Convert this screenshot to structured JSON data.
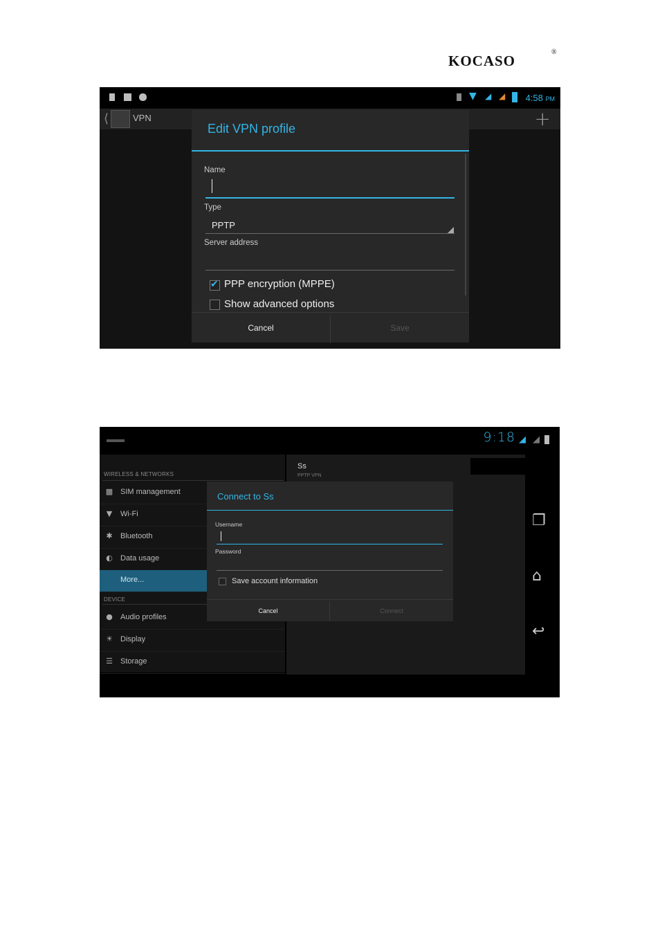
{
  "logo": {
    "brand": "KOCASO",
    "reg_mark": "®"
  },
  "screenshot1": {
    "status_bar": {
      "time": "4:58",
      "ampm": "PM"
    },
    "action_bar": {
      "title": "VPN"
    },
    "dialog": {
      "title": "Edit VPN profile",
      "name_label": "Name",
      "name_value": "",
      "type_label": "Type",
      "type_value": "PPTP",
      "server_label": "Server address",
      "server_value": "",
      "ppp_encryption_label": "PPP encryption (MPPE)",
      "ppp_encryption_checked": true,
      "advanced_label": "Show advanced options",
      "advanced_checked": false,
      "cancel_label": "Cancel",
      "save_label": "Save"
    }
  },
  "screenshot2": {
    "status_bar": {
      "time": "9:18"
    },
    "settings": {
      "wireless_header": "WIRELESS & NETWORKS",
      "device_header": "DEVICE",
      "items": [
        {
          "label": "SIM management",
          "icon": "sim-icon"
        },
        {
          "label": "Wi-Fi",
          "icon": "wifi-icon"
        },
        {
          "label": "Bluetooth",
          "icon": "bluetooth-icon"
        },
        {
          "label": "Data usage",
          "icon": "data-usage-icon"
        },
        {
          "label": "More...",
          "icon": "none",
          "selected": true
        }
      ],
      "device_items": [
        {
          "label": "Audio profiles",
          "icon": "audio-icon"
        },
        {
          "label": "Display",
          "icon": "display-icon"
        },
        {
          "label": "Storage",
          "icon": "storage-icon"
        }
      ]
    },
    "vpn_entry": {
      "name": "Ss",
      "type": "PPTP VPN"
    },
    "dialog": {
      "title": "Connect to Ss",
      "username_label": "Username",
      "username_value": "",
      "password_label": "Password",
      "password_value": "",
      "save_info_label": "Save account information",
      "save_info_checked": false,
      "cancel_label": "Cancel",
      "connect_label": "Connect"
    }
  },
  "colors": {
    "accent": "#33b5e5",
    "dialog_bg": "#282828",
    "selected_item": "#1e5f7d"
  }
}
